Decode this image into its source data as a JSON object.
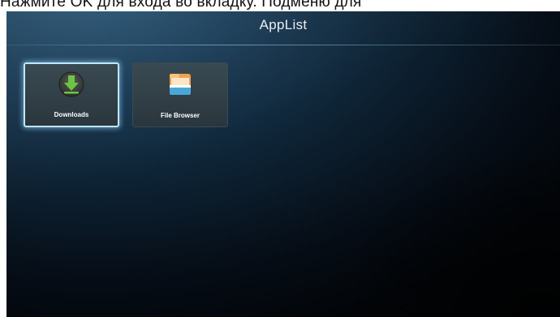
{
  "caption_strip": {
    "text": "Нажмите OK для входа во вкладку. Подменю для"
  },
  "header": {
    "title": "AppList"
  },
  "apps": [
    {
      "label": "Downloads",
      "icon": "download-icon",
      "selected": true
    },
    {
      "label": "File Browser",
      "icon": "folder-icon",
      "selected": false
    }
  ],
  "colors": {
    "selection_glow": "#bfe8ff",
    "download_icon_green": "#6cc644",
    "folder_orange": "#f0a050",
    "folder_blue": "#4aa8d8"
  }
}
